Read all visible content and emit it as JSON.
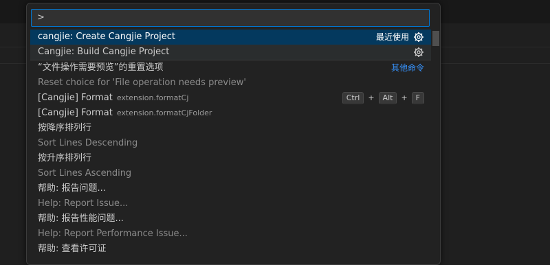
{
  "palette": {
    "input_value": ">",
    "items": [
      {
        "label": "cangjie: Create Cangjie Project",
        "tag": "最近使用",
        "gear": "gear-icon"
      },
      {
        "label": "Cangjie: Build Cangjie Project",
        "gear": "gear-icon"
      },
      {
        "label": "“文件操作需要预览”的重置选项",
        "link": "其他命令"
      },
      {
        "label": "Reset choice for 'File operation needs preview'"
      },
      {
        "label": "[Cangjie] Format",
        "desc": "extension.formatCj",
        "keys": [
          "Ctrl",
          "+",
          "Alt",
          "+",
          "F"
        ]
      },
      {
        "label": "[Cangjie] Format",
        "desc": "extension.formatCjFolder"
      },
      {
        "label": "按降序排列行"
      },
      {
        "label": "Sort Lines Descending"
      },
      {
        "label": "按升序排列行"
      },
      {
        "label": "Sort Lines Ascending"
      },
      {
        "label": "帮助: 报告问题..."
      },
      {
        "label": "Help: Report Issue..."
      },
      {
        "label": "帮助: 报告性能问题..."
      },
      {
        "label": "Help: Report Performance Issue..."
      },
      {
        "label": "帮助: 查看许可证"
      }
    ]
  },
  "colors": {
    "accent": "#0078d4",
    "selected": "#04395e",
    "link": "#3794ff"
  }
}
